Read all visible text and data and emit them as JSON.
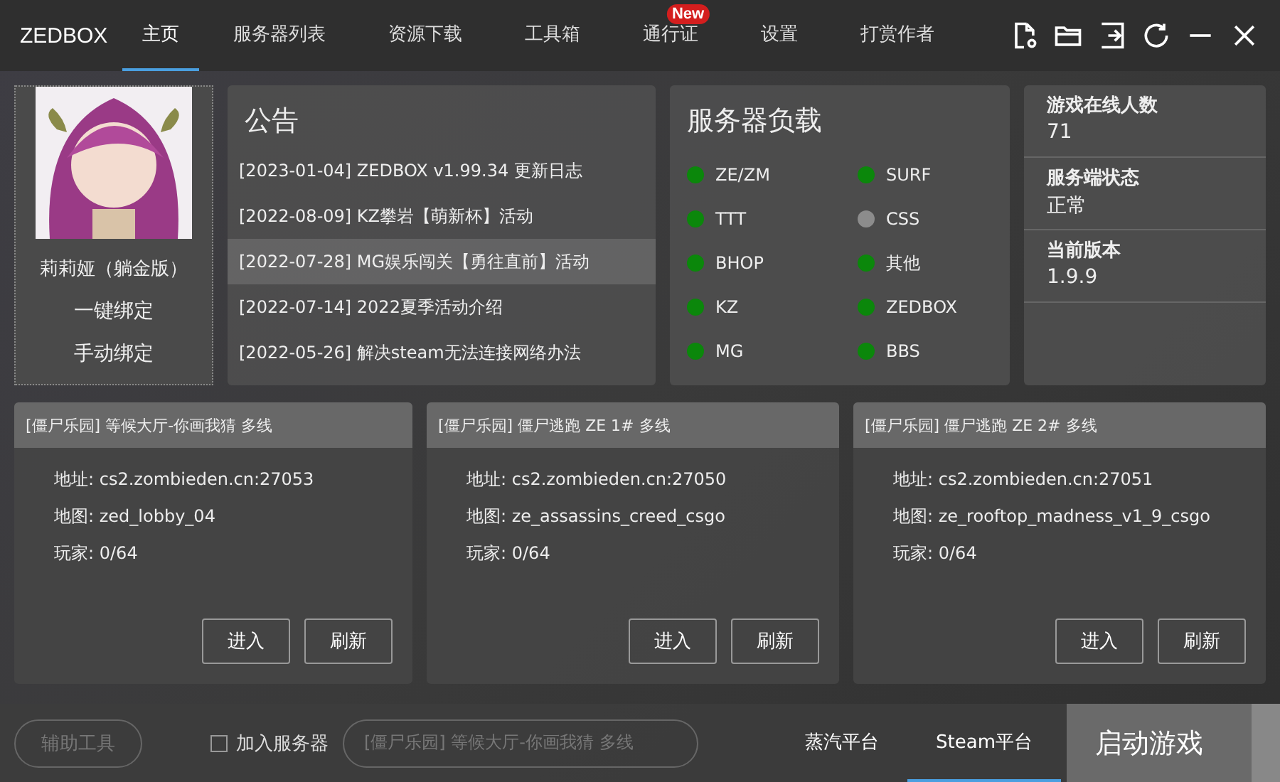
{
  "app": {
    "title": "ZEDBOX"
  },
  "nav": [
    {
      "label": "主页",
      "selected": true
    },
    {
      "label": "服务器列表",
      "selected": false
    },
    {
      "label": "资源下载",
      "selected": false
    },
    {
      "label": "工具箱",
      "selected": false
    },
    {
      "label": "通行证",
      "selected": false,
      "badge": "New"
    },
    {
      "label": "设置",
      "selected": false
    },
    {
      "label": "打赏作者",
      "selected": false
    }
  ],
  "profile": {
    "name": "莉莉娅（躺金版）",
    "actions": [
      "一键绑定",
      "手动绑定"
    ]
  },
  "notices": {
    "title": "公告",
    "items": [
      {
        "text": "[2023-01-04] ZEDBOX v1.99.34 更新日志",
        "selected": false
      },
      {
        "text": "[2022-08-09] KZ攀岩【萌新杯】活动",
        "selected": false
      },
      {
        "text": "[2022-07-28] MG娱乐闯关【勇往直前】活动",
        "selected": true
      },
      {
        "text": "[2022-07-14] 2022夏季活动介绍",
        "selected": false
      },
      {
        "text": "[2022-05-26] 解决steam无法连接网络办法",
        "selected": false
      }
    ]
  },
  "server_load": {
    "title": "服务器负载",
    "items": [
      {
        "name": "ZE/ZM",
        "color": "#0b870b"
      },
      {
        "name": "SURF",
        "color": "#0b870b"
      },
      {
        "name": "TTT",
        "color": "#0b870b"
      },
      {
        "name": "CSS",
        "color": "#8c8c8c"
      },
      {
        "name": "BHOP",
        "color": "#0b870b"
      },
      {
        "name": "其他",
        "color": "#0b870b"
      },
      {
        "name": "KZ",
        "color": "#0b870b"
      },
      {
        "name": "ZEDBOX",
        "color": "#0b870b"
      },
      {
        "name": "MG",
        "color": "#0b870b"
      },
      {
        "name": "BBS",
        "color": "#0b870b"
      }
    ]
  },
  "stats": [
    {
      "label": "游戏在线人数",
      "value": "71"
    },
    {
      "label": "服务端状态",
      "value": "正常"
    },
    {
      "label": "当前版本",
      "value": "1.9.9"
    }
  ],
  "servers": [
    {
      "title": "[僵尸乐园] 等候大厅-你画我猜 多线",
      "fields": [
        {
          "label": "地址:",
          "value": "cs2.zombieden.cn:27053"
        },
        {
          "label": "地图:",
          "value": "zed_lobby_04"
        },
        {
          "label": "玩家:",
          "value": "0/64"
        }
      ],
      "buttons": [
        "进入",
        "刷新"
      ]
    },
    {
      "title": "[僵尸乐园] 僵尸逃跑 ZE 1# 多线",
      "fields": [
        {
          "label": "地址:",
          "value": "cs2.zombieden.cn:27050"
        },
        {
          "label": "地图:",
          "value": "ze_assassins_creed_csgo"
        },
        {
          "label": "玩家:",
          "value": "0/64"
        }
      ],
      "buttons": [
        "进入",
        "刷新"
      ]
    },
    {
      "title": "[僵尸乐园] 僵尸逃跑 ZE 2# 多线",
      "fields": [
        {
          "label": "地址:",
          "value": "cs2.zombieden.cn:27051"
        },
        {
          "label": "地图:",
          "value": "ze_rooftop_madness_v1_9_csgo"
        },
        {
          "label": "玩家:",
          "value": "0/64"
        }
      ],
      "buttons": [
        "进入",
        "刷新"
      ]
    }
  ],
  "bottom": {
    "tool_button": {
      "label": "辅助工具",
      "disabled": true
    },
    "join_server": {
      "label": "加入服务器",
      "checked": false
    },
    "server_select": {
      "value": "[僵尸乐园] 等候大厅-你画我猜 多线",
      "disabled": true
    },
    "platforms": [
      {
        "label": "蒸汽平台",
        "selected": false
      },
      {
        "label": "Steam平台",
        "selected": true
      }
    ],
    "launch": "启动游戏"
  }
}
